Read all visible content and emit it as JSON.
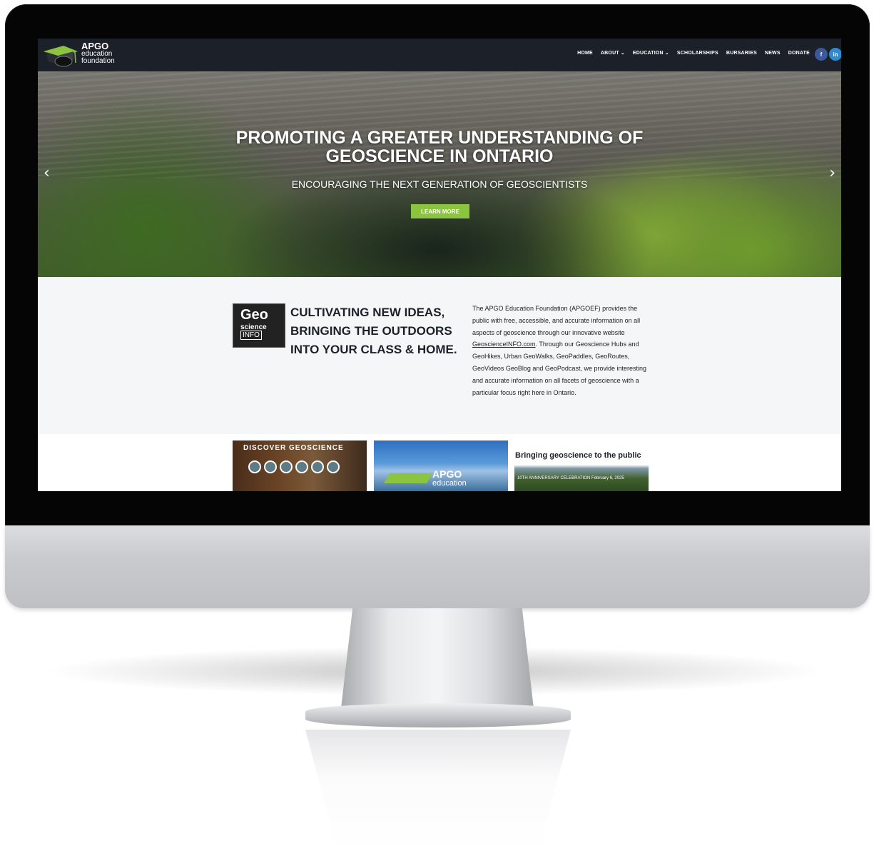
{
  "logo": {
    "line1": "APGO",
    "line2": "education",
    "line3": "foundation"
  },
  "nav": {
    "items": [
      {
        "label": "HOME",
        "dropdown": false
      },
      {
        "label": "ABOUT",
        "dropdown": true
      },
      {
        "label": "EDUCATION",
        "dropdown": true
      },
      {
        "label": "SCHOLARSHIPS",
        "dropdown": false
      },
      {
        "label": "BURSARIES",
        "dropdown": false
      },
      {
        "label": "NEWS",
        "dropdown": false
      },
      {
        "label": "DONATE",
        "dropdown": false
      }
    ],
    "social": [
      "facebook-icon",
      "linkedin-icon"
    ]
  },
  "hero": {
    "title_line1": "PROMOTING A GREATER UNDERSTANDING OF",
    "title_line2": "GEOSCIENCE IN ONTARIO",
    "subtitle": "ENCOURAGING THE NEXT GENERATION OF GEOSCIENTISTS",
    "button": "LEARN MORE"
  },
  "intro": {
    "logo": {
      "geo": "Geo",
      "science": "science",
      "info": "INFO"
    },
    "heading": "CULTIVATING NEW IDEAS, BRINGING THE OUTDOORS INTO YOUR CLASS & HOME.",
    "text_before_link": "The APGO Education Foundation (APGOEF) provides the public with free, accessible, and accurate information on all aspects of geoscience through our innovative website ",
    "link": "GeoscienceINFO.com",
    "text_after_link": ". Through our Geoscience Hubs and GeoHikes, Urban GeoWalks, GeoPaddles, GeoRoutes, GeoVideos GeoBlog and GeoPodcast, we provide interesting and accurate information on all facets of geoscience with a particular focus right here in Ontario."
  },
  "cards": {
    "card1_title": "DISCOVER GEOSCIENCE",
    "card2_line1": "APGO",
    "card2_line2": "education",
    "card3_title": "Bringing geoscience to the public",
    "card3_sub": "10TH ANNIVERSARY CELEBRATION February 6, 2025"
  },
  "colors": {
    "nav_bg": "#1c2028",
    "accent_green": "#8bc53f",
    "facebook": "#3b5998",
    "linkedin": "#2e8bd0"
  }
}
